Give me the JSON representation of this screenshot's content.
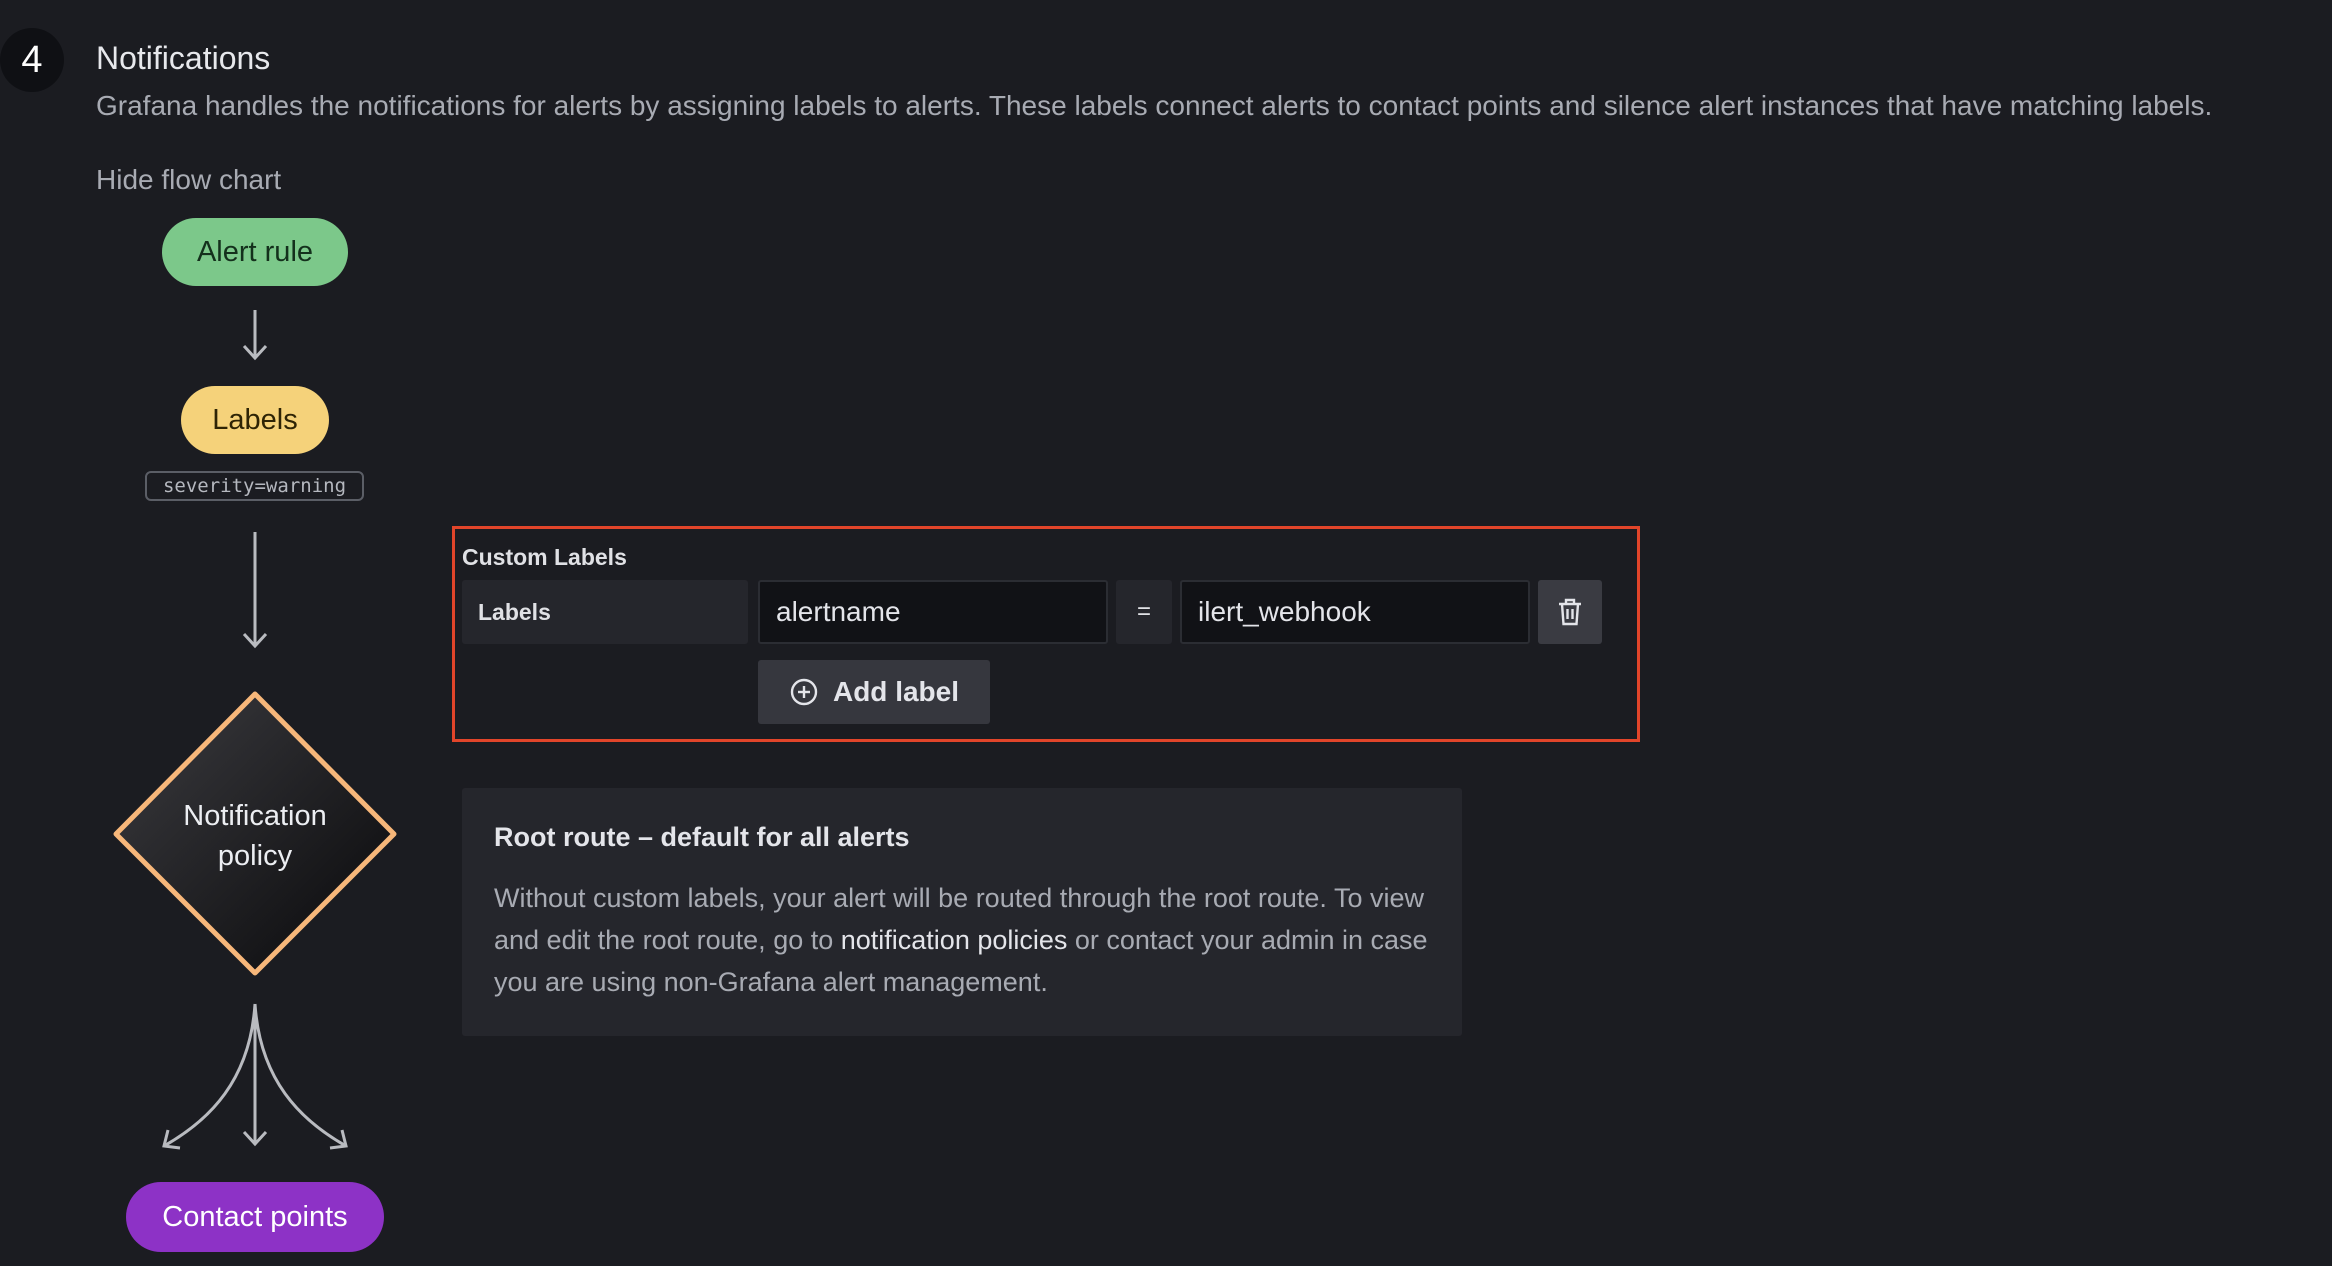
{
  "step": {
    "number": "4",
    "title": "Notifications",
    "description": "Grafana handles the notifications for alerts by assigning labels to alerts. These labels connect alerts to contact points and silence alert instances that have matching labels.",
    "toggle_label": "Hide flow chart"
  },
  "flow_chart": {
    "alert_rule": "Alert rule",
    "labels": "Labels",
    "example_label": "severity=warning",
    "policy_line1": "Notification",
    "policy_line2": "policy",
    "contact_points": "Contact points",
    "colors": {
      "alert_rule": "#7cc88a",
      "labels": "#f5d27a",
      "policy_border": "#f7b77a",
      "contact_points": "#8d32c6"
    }
  },
  "custom_labels": {
    "title": "Custom Labels",
    "row_label": "Labels",
    "key_value": "alertname",
    "operator": "=",
    "value_value": "ilert_webhook",
    "add_label": "Add label",
    "highlight_color": "#e2452a"
  },
  "root_route": {
    "title": "Root route – default for all alerts",
    "body_before": "Without custom labels, your alert will be routed through the root route. To view and edit the root route, go to ",
    "link_text": "notification policies",
    "body_after": " or contact your admin in case you are using non-Grafana alert management."
  }
}
